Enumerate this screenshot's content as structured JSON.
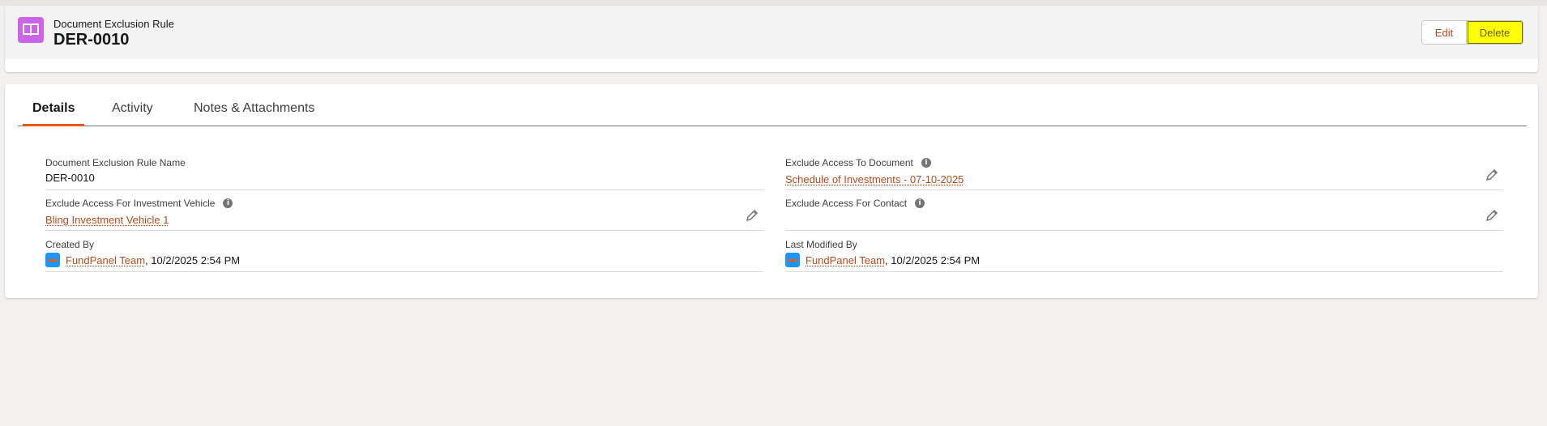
{
  "header": {
    "object_type": "Document Exclusion Rule",
    "record_name": "DER-0010",
    "icon": "document-book-icon",
    "buttons": {
      "edit": "Edit",
      "delete": "Delete"
    }
  },
  "tabs": [
    "Details",
    "Activity",
    "Notes & Attachments"
  ],
  "active_tab": "Details",
  "fields": {
    "name": {
      "label": "Document Exclusion Rule Name",
      "value": "DER-0010"
    },
    "document": {
      "label": "Exclude Access To Document",
      "value": "Schedule of Investments - 07-10-2025"
    },
    "vehicle": {
      "label": "Exclude Access For Investment Vehicle",
      "value": "Bling Investment Vehicle 1"
    },
    "contact": {
      "label": "Exclude Access For Contact",
      "value": ""
    },
    "created_by": {
      "label": "Created By",
      "user": "FundPanel Team",
      "timestamp": ", 10/2/2025 2:54 PM"
    },
    "modified_by": {
      "label": "Last Modified By",
      "user": "FundPanel Team",
      "timestamp": ", 10/2/2025 2:54 PM"
    }
  },
  "colors": {
    "accent": "#e8591a",
    "link": "#ba4a1b",
    "icon_bg": "#cb65e8",
    "highlight": "#ffff00"
  }
}
